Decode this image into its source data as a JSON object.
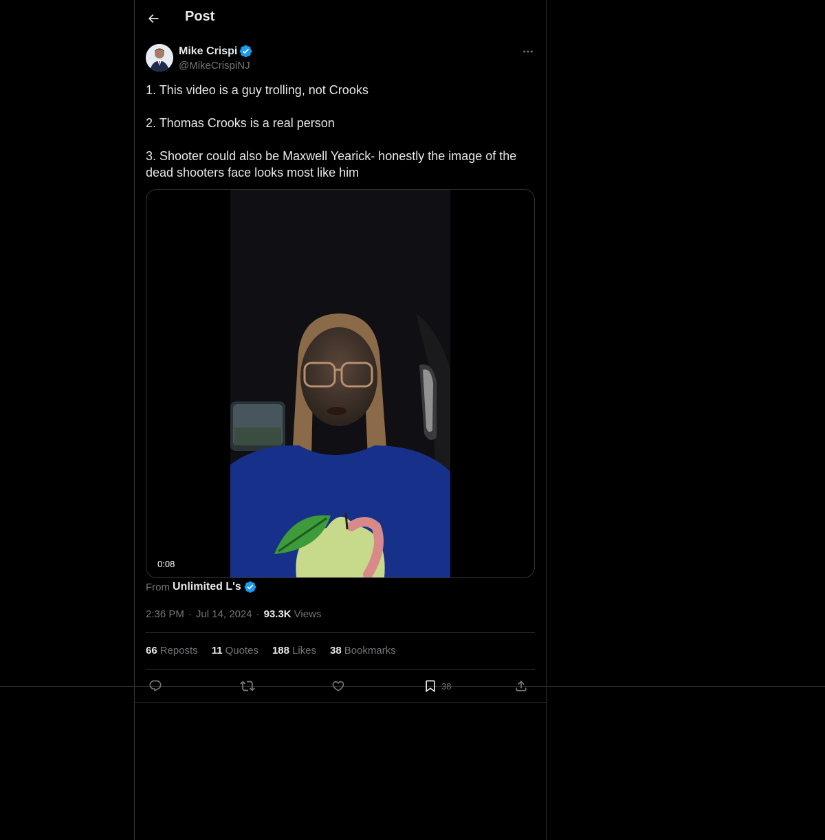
{
  "header": {
    "title": "Post"
  },
  "author": {
    "name": "Mike Crispi",
    "handle": "@MikeCrispiNJ",
    "verified": true
  },
  "tweet": {
    "lines": [
      "1. This video is a guy trolling, not Crooks",
      "2. Thomas Crooks is a real person",
      "3. Shooter could also be Maxwell Yearick- honestly the image of the dead shooters face looks most like him"
    ]
  },
  "media": {
    "duration": "0:08"
  },
  "source": {
    "prefix": "From",
    "name": "Unlimited L's",
    "verified": true
  },
  "meta": {
    "time": "2:36 PM",
    "date": "Jul 14, 2024",
    "views_count": "93.3K",
    "views_label": "Views",
    "separator": "·"
  },
  "stats": [
    {
      "count": "66",
      "label": "Reposts"
    },
    {
      "count": "11",
      "label": "Quotes"
    },
    {
      "count": "188",
      "label": "Likes"
    },
    {
      "count": "38",
      "label": "Bookmarks"
    }
  ],
  "actions": {
    "bookmark_count": "38"
  },
  "colors": {
    "background": "#000000",
    "text": "#e7e9ea",
    "secondary": "#71767b",
    "border": "#2f3336",
    "verified": "#1d9bf0"
  }
}
